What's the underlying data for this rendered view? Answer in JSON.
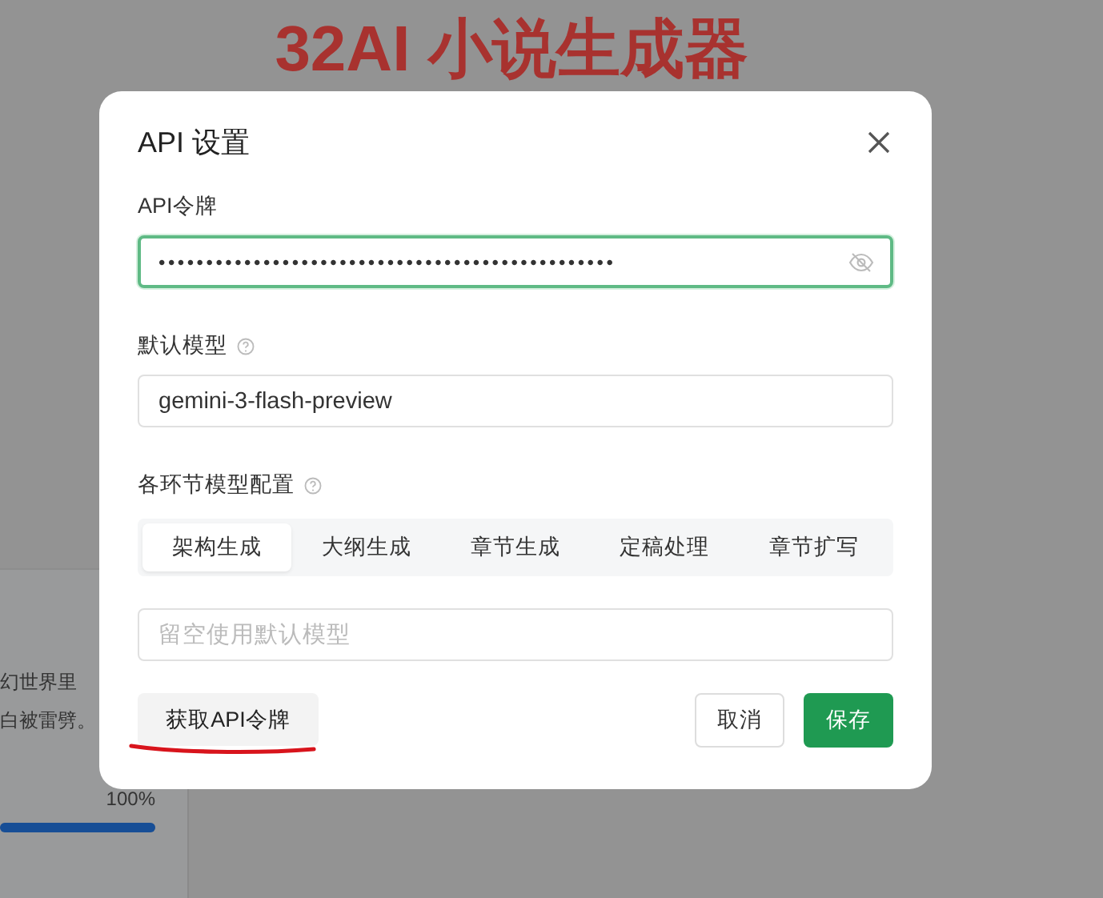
{
  "page": {
    "title": "32AI 小说生成器",
    "card": {
      "lines": [
        "幻世界里",
        "白被雷劈。"
      ],
      "progress": {
        "reading": "100%",
        "level": 1
      }
    }
  },
  "dialog": {
    "title": "API 设置",
    "token": {
      "label": "API令牌",
      "value": "••••••••••••••••••••••••••••••••••••••••••••••••",
      "focused": true
    },
    "model": {
      "label": "默认模型",
      "value": "gemini-3-flash-preview"
    },
    "stages": {
      "label": "各环节模型配置",
      "tabs": [
        {
          "label": "架构生成",
          "selected": true
        },
        {
          "label": "大纲生成",
          "selected": false
        },
        {
          "label": "章节生成",
          "selected": false
        },
        {
          "label": "定稿处理",
          "selected": false
        },
        {
          "label": "章节扩写",
          "selected": false
        }
      ],
      "placeholder": "留空使用默认模型"
    },
    "buttons": {
      "get_token": "获取API令牌",
      "cancel": "取消",
      "save": "保存"
    }
  }
}
